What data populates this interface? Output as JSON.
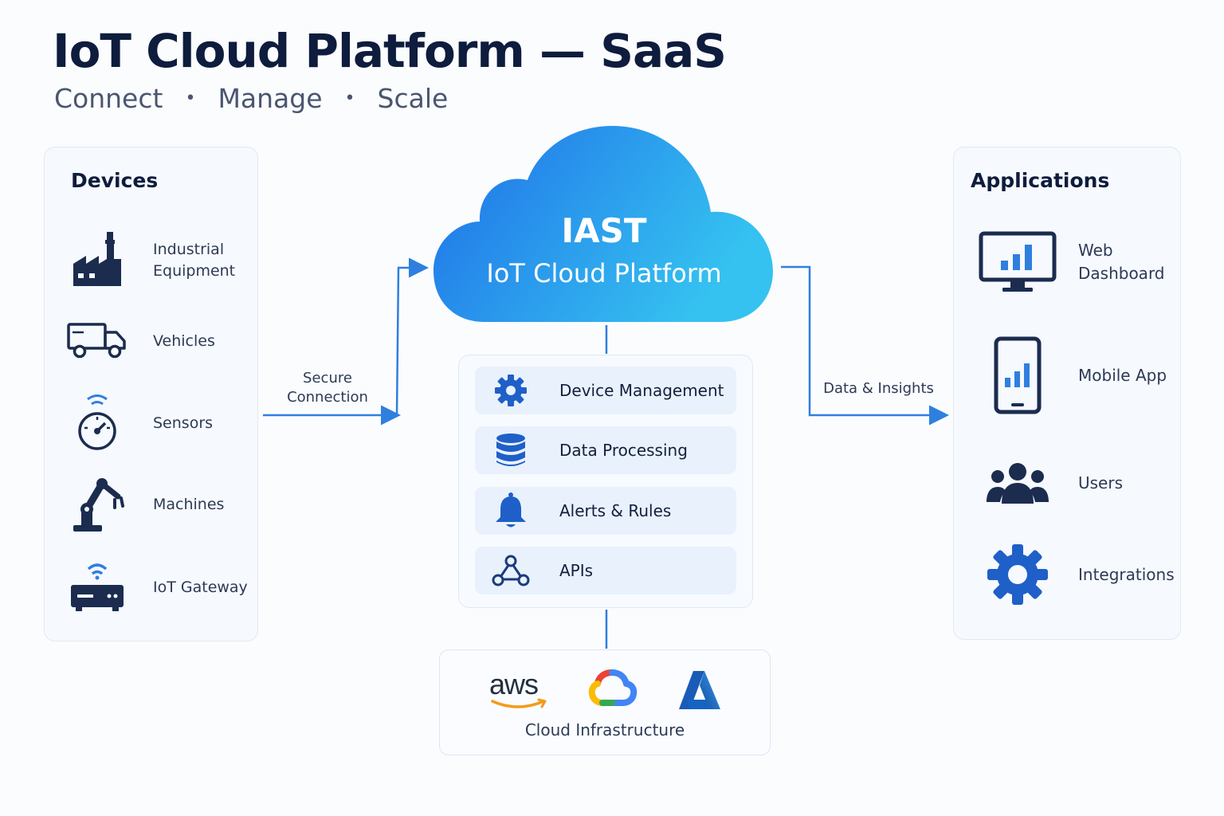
{
  "header": {
    "title": "IoT Cloud Platform — SaaS",
    "tagline": [
      "Connect",
      "Manage",
      "Scale"
    ],
    "separator": "•"
  },
  "devices": {
    "title": "Devices",
    "items": [
      {
        "label": "Industrial\nEquipment",
        "icon": "factory-icon"
      },
      {
        "label": "Vehicles",
        "icon": "truck-icon"
      },
      {
        "label": "Sensors",
        "icon": "sensor-gauge-icon"
      },
      {
        "label": "Machines",
        "icon": "robot-arm-icon"
      },
      {
        "label": "IoT Gateway",
        "icon": "router-icon"
      }
    ]
  },
  "cloud": {
    "name": "IAST",
    "subtitle": "IoT Cloud Platform"
  },
  "services": [
    {
      "label": "Device Management",
      "icon": "gear-icon"
    },
    {
      "label": "Data Processing",
      "icon": "database-icon"
    },
    {
      "label": "Alerts & Rules",
      "icon": "bell-icon"
    },
    {
      "label": "APIs",
      "icon": "network-nodes-icon"
    }
  ],
  "connections": {
    "inbound": "Secure\nConnection",
    "outbound": "Data & Insights"
  },
  "infrastructure": {
    "caption": "Cloud Infrastructure",
    "providers": [
      "aws"
    ]
  },
  "applications": {
    "title": "Applications",
    "items": [
      {
        "label": "Web\nDashboard",
        "icon": "monitor-chart-icon"
      },
      {
        "label": "Mobile App",
        "icon": "phone-chart-icon"
      },
      {
        "label": "Users",
        "icon": "users-icon"
      },
      {
        "label": "Integrations",
        "icon": "gear-icon"
      }
    ]
  },
  "colors": {
    "navy": "#1b2c4f",
    "accent": "#2f7fe0",
    "cloud_start": "#1f6fe8",
    "cloud_end": "#35c2f0"
  }
}
